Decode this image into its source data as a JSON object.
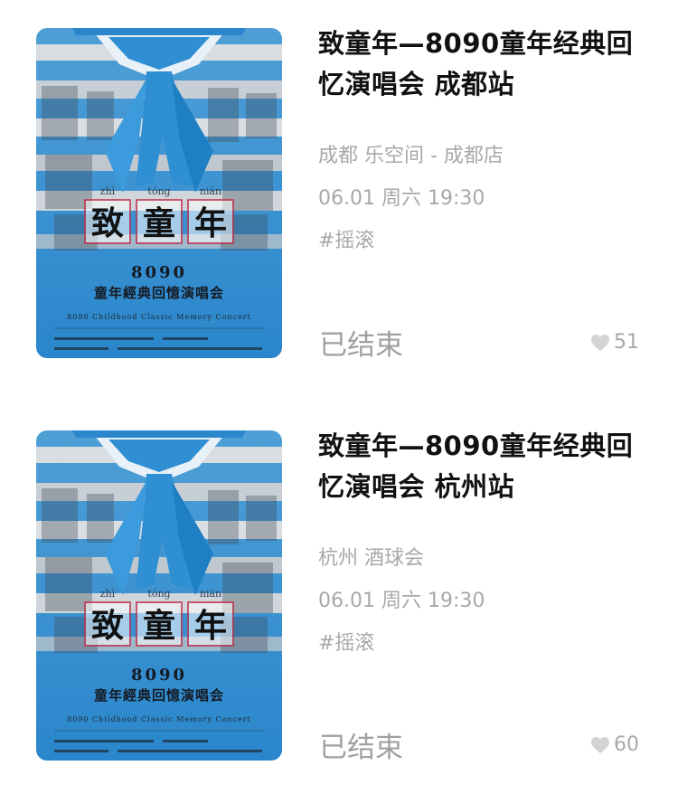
{
  "events": [
    {
      "title": "致童年—8090童年经典回忆演唱会 成都站",
      "venue": "成都 乐空间 - 成都店",
      "datetime": "06.01 周六 19:30",
      "tag": "#摇滚",
      "status": "已结束",
      "likes": "51",
      "poster": {
        "pinyin": [
          "zhì",
          "tóng",
          "nián"
        ],
        "chars": [
          "致",
          "童",
          "年"
        ],
        "line1": "8090",
        "line2": "童年經典回憶演唱会",
        "line3": "8090 Childhood Classic Memory Concert"
      }
    },
    {
      "title": "致童年—8090童年经典回忆演唱会 杭州站",
      "venue": "杭州 酒球会",
      "datetime": "06.01 周六 19:30",
      "tag": "#摇滚",
      "status": "已结束",
      "likes": "60",
      "poster": {
        "pinyin": [
          "zhì",
          "tóng",
          "nián"
        ],
        "chars": [
          "致",
          "童",
          "年"
        ],
        "line1": "8090",
        "line2": "童年經典回憶演唱会",
        "line3": "8090 Childhood Classic Memory Concert"
      }
    }
  ]
}
